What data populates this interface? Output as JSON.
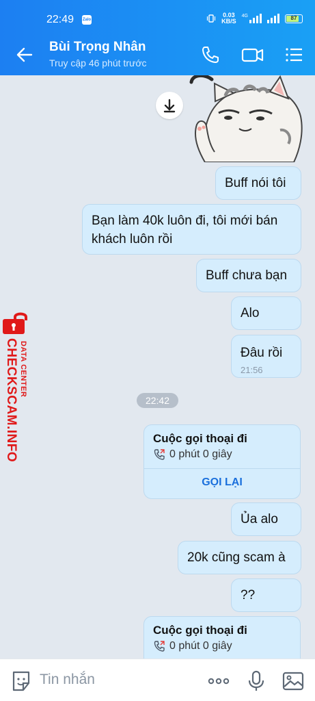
{
  "status_bar": {
    "time": "22:49",
    "app_badge": "Zalo",
    "net_speed_value": "0.03",
    "net_speed_unit": "KB/S",
    "network_type": "4G",
    "battery": "87"
  },
  "header": {
    "contact_name": "Bùi Trọng Nhân",
    "last_seen": "Truy cập 46 phút trước",
    "icons": [
      "back-arrow-icon",
      "phone-icon",
      "video-call-icon",
      "menu-list-icon"
    ]
  },
  "messages": [
    {
      "text": "Buff nói tôi"
    },
    {
      "text": "Bạn làm 40k luôn đi, tôi mới bán khách luôn rồi"
    },
    {
      "text": "Buff chưa bạn"
    },
    {
      "text": "Alo"
    },
    {
      "text": "Đâu rồi",
      "time": "21:56"
    },
    {
      "text": "Ủa alo"
    },
    {
      "text": "20k cũng scam à"
    },
    {
      "text": "??"
    }
  ],
  "time_separator": "22:42",
  "calls": [
    {
      "title": "Cuộc gọi thoại đi",
      "duration": "0 phút 0 giây",
      "action": "GỌI LẠI"
    },
    {
      "title": "Cuộc gọi thoại đi",
      "duration": "0 phút 0 giây"
    }
  ],
  "watermark": {
    "main": "CHECKSCAM.INFO",
    "sub": "DATA CENTER"
  },
  "composer": {
    "placeholder": "Tin nhắn",
    "icons": [
      "sticker-icon",
      "more-icon",
      "microphone-icon",
      "image-icon"
    ]
  },
  "colors": {
    "header_start": "#1c7ff2",
    "header_end": "#1aa0f5",
    "bubble": "#d5edfd",
    "chat_bg": "#e2e8ef",
    "watermark": "#e01919",
    "link": "#1a6fdc"
  }
}
